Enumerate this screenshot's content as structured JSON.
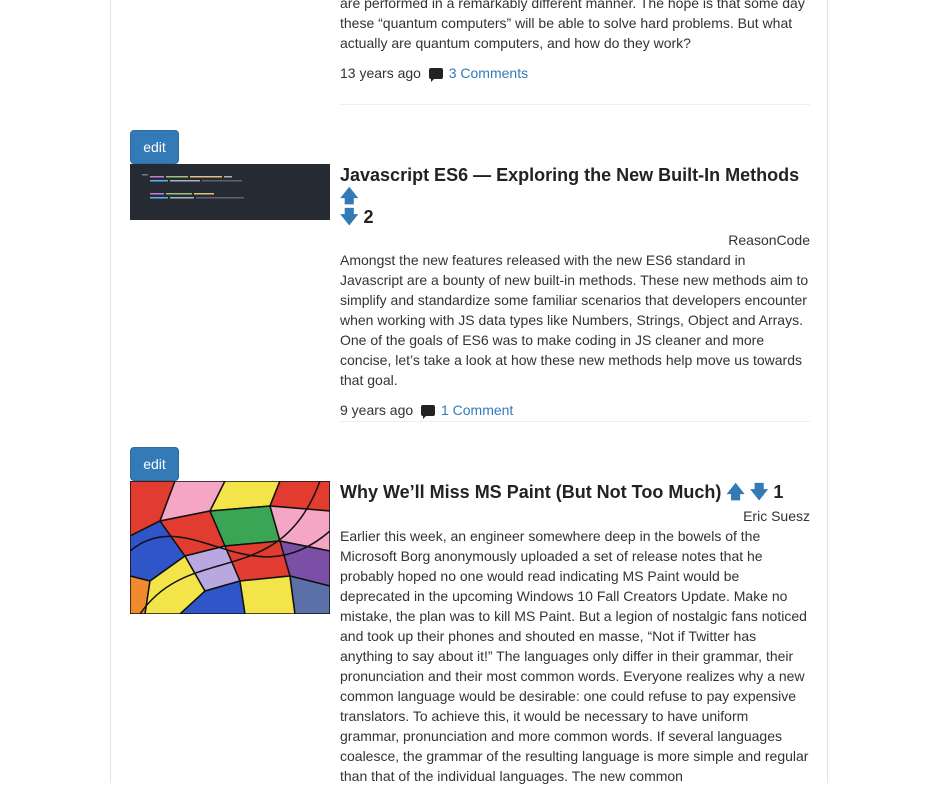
{
  "posts": [
    {
      "body_partial": "are performed in a remarkably different manner. The hope is that some day these “quantum computers” will be able to solve hard problems. But what actually are quantum computers, and how do they work?",
      "time": "13 years ago",
      "comments": "3 Comments",
      "comment_icon": "comment-icon"
    },
    {
      "edit_label": "edit",
      "title": "Javascript ES6 — Exploring the New Built-In Methods",
      "upvote_icon": "arrow-up-icon",
      "downvote_icon": "arrow-down-icon",
      "votes": "2",
      "author": "ReasonCode",
      "body": "Amongst the new features released with the new ES6 standard in Javascript are a bounty of new built-in methods. These new methods aim to simplify and standardize some familiar scenarios that developers encounter when working with JS data types like Numbers, Strings, Object and Arrays. One of the goals of ES6 was to make coding in JS cleaner and more concise, let’s take a look at how these new methods help move us towards that goal.",
      "time": "9 years ago",
      "comments": "1 Comment",
      "comment_icon": "comment-icon"
    },
    {
      "edit_label": "edit",
      "title": "Why We’ll Miss MS Paint (But Not Too Much)",
      "upvote_icon": "arrow-up-icon",
      "downvote_icon": "arrow-down-icon",
      "votes": "1",
      "author": "Eric Suesz",
      "body": "Earlier this week, an engineer somewhere deep in the bowels of the Microsoft Borg anonymously uploaded a set of release notes that he probably hoped no one would read indicating MS Paint would be deprecated in the upcoming Windows 10 Fall Creators Update. Make no mistake, the plan was to kill MS Paint. But a legion of nostalgic fans noticed and took up their phones and shouted en masse, “Not if Twitter has anything to say about it!” The languages only differ in their grammar, their pronunciation and their most common words. Everyone realizes why a new common language would be desirable: one could refuse to pay expensive translators. To achieve this, it would be necessary to have uniform grammar, pronunciation and more common words. If several languages coalesce, the grammar of the resulting language is more simple and regular than that of the individual languages. The new common"
    }
  ]
}
